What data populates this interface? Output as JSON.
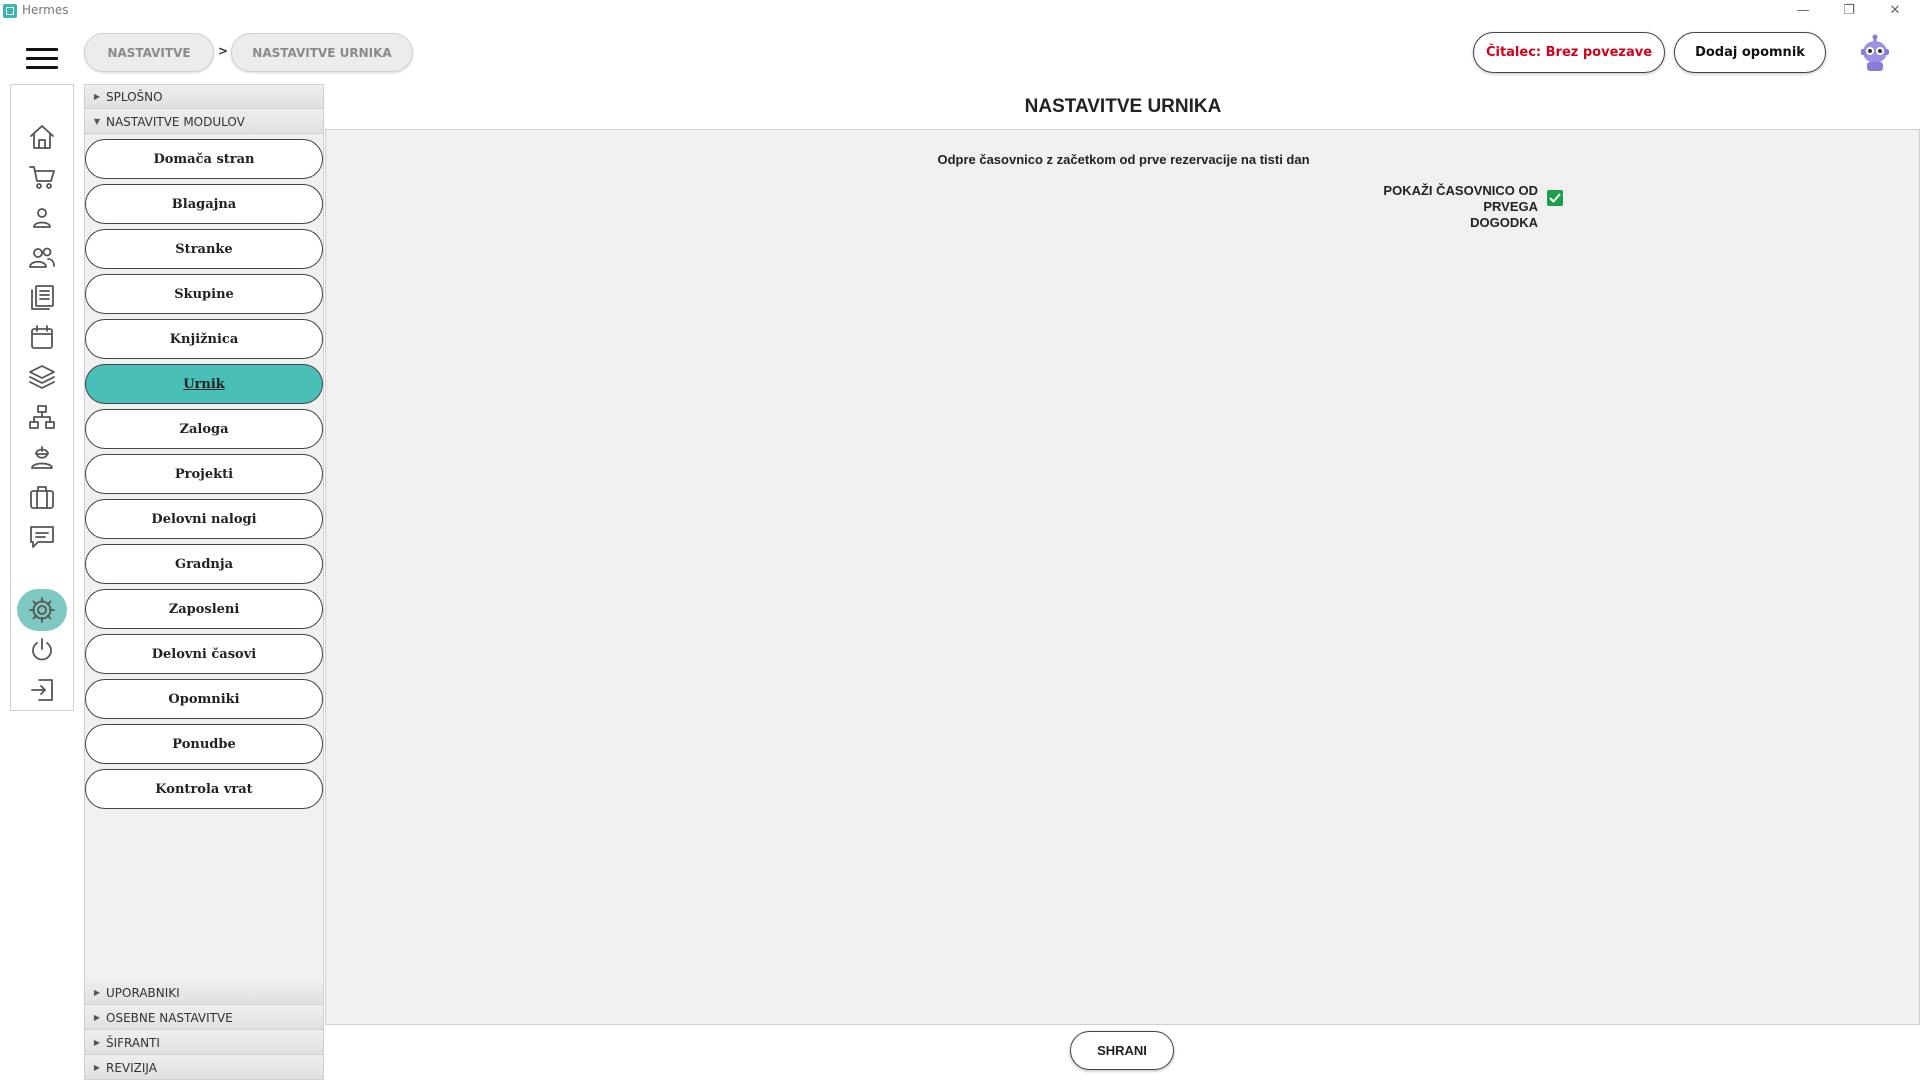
{
  "window": {
    "title": "Hermes",
    "minimize": "—",
    "maximize": "❐",
    "close": "✕"
  },
  "breadcrumb": {
    "items": [
      "NASTAVITVE",
      "NASTAVITVE URNIKA"
    ],
    "separator": ">"
  },
  "header": {
    "reader_status": "Čitalec: Brez povezave",
    "add_reminder": "Dodaj opomnik"
  },
  "rail": {
    "icons": [
      "home-icon",
      "cart-icon",
      "person-icon",
      "people-icon",
      "documents-icon",
      "calendar-icon",
      "layers-icon",
      "hierarchy-icon",
      "worker-icon",
      "briefcase-icon",
      "chat-icon",
      "gear-icon",
      "power-icon",
      "logout-icon"
    ],
    "active": "gear-icon"
  },
  "nav": {
    "sections_top": [
      "SPLOŠNO",
      "NASTAVITVE MODULOV"
    ],
    "modules": [
      "Domača stran",
      "Blagajna",
      "Stranke",
      "Skupine",
      "Knjižnica",
      "Urnik",
      "Zaloga",
      "Projekti",
      "Delovni nalogi",
      "Gradnja",
      "Zaposleni",
      "Delovni časovi",
      "Opomniki",
      "Ponudbe",
      "Kontrola vrat"
    ],
    "active_module": "Urnik",
    "sections_bottom": [
      "UPORABNIKI",
      "OSEBNE NASTAVITVE",
      "ŠIFRANTI",
      "REVIZIJA"
    ]
  },
  "main": {
    "title": "NASTAVITVE URNIKA",
    "description": "Odpre časovnico z začetkom od prve rezervacije na tisti dan",
    "checkbox": {
      "label_line1": "POKAŽI ČASOVNICO OD PRVEGA",
      "label_line2": "DOGODKA",
      "checked": true
    },
    "save": "SHRANI"
  },
  "colors": {
    "accent": "#48c0b8",
    "rail_active": "#7fc9c3",
    "reader_status": "#d0021b",
    "checkbox": "#1e9e4a"
  }
}
